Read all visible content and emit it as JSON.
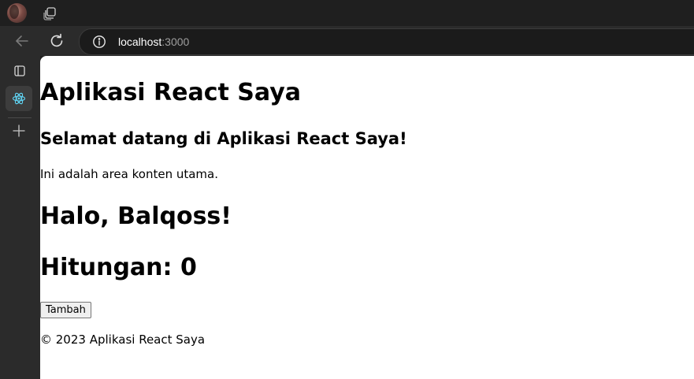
{
  "browser": {
    "url_host": "localhost",
    "url_port": ":3000",
    "icons": {
      "profile": "avatar",
      "workspaces": "workspaces-icon",
      "back": "arrow-left-icon",
      "refresh": "refresh-icon",
      "site_info": "info-icon",
      "tab_actions": "tab-actions-icon",
      "active_tab": "react-logo-icon",
      "new_tab": "plus-icon"
    },
    "colors": {
      "chrome_dark": "#1f1f1f",
      "toolbar": "#2b2b2b",
      "react_accent": "#61dafb"
    }
  },
  "page": {
    "app_title": "Aplikasi React Saya",
    "welcome_heading": "Selamat datang di Aplikasi React Saya!",
    "main_text": "Ini adalah area konten utama.",
    "greeting": "Halo, Balqoss!",
    "counter": "Hitungan: 0",
    "add_button_label": "Tambah",
    "footer": "© 2023 Aplikasi React Saya"
  }
}
